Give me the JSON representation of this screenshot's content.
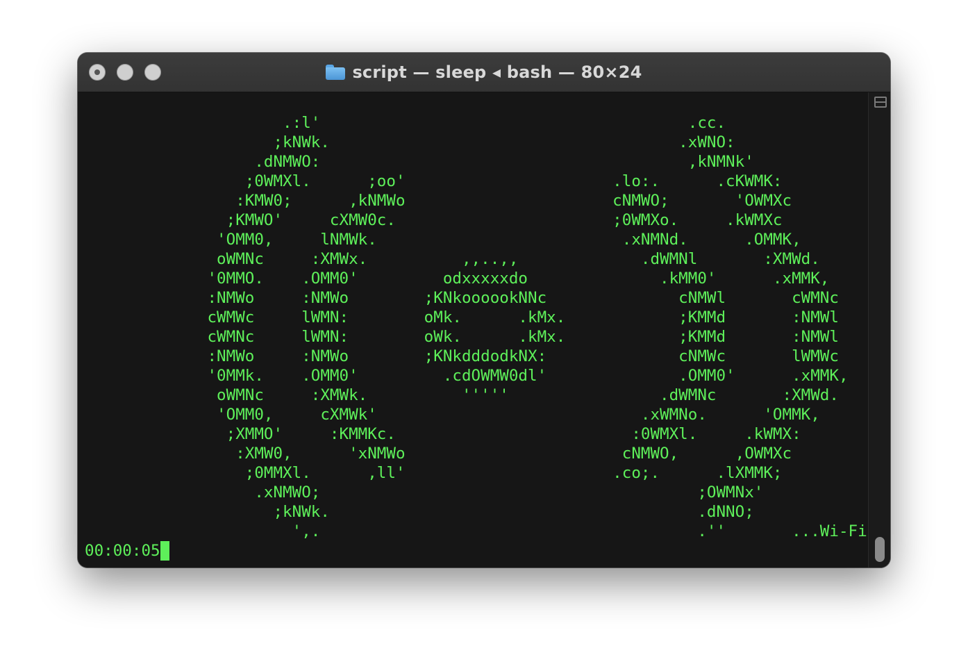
{
  "window": {
    "title": "script — sleep ◂ bash — 80×24",
    "folder_icon": "folder-icon"
  },
  "terminal": {
    "lines": [
      "                     .:l'                                       .cc.",
      "                    ;kNWk.                                     .xWNO:",
      "                  .dNMWO:                                       ,kNMNk'",
      "                 ;0WMXl.      ;oo'                      .lo:.      .cKWMK:",
      "                :KMW0;      ,kNMWo                      cNMWO;       'OWMXc",
      "               ;KMWO'     cXMW0c.                       ;0WMXo.     .kWMXc",
      "              'OMM0,     lNMWk.                          .xNMNd.      .OMMK,",
      "              oWMNc     :XMWx.          ,,..,,             .dWMNl       :XMWd.",
      "             '0MMO.    .OMM0'         odxxxxxdo              .kMM0'      .xMMK,",
      "             :NMWo     :NMWo        ;KNkoooookNNc              cNMWl       cWMNc",
      "             cWMWc     lWMN:        oMk.      .kMx.            ;KMMd       :NMWl",
      "             cWMNc     lWMN:        oWk.      .kMx.            ;KMMd       :NMWl",
      "             :NMWo     :NMWo        ;KNkdddodkNX:              cNMWc       lWMWc",
      "             '0MMk.    .OMM0'         .cdOWMW0dl'              .OMM0'      .xMMK,",
      "              oWMNc     :XMWk.          '''''                .dWMNc       :XMWd.",
      "              'OMM0,     cXMWk'                            .xWMNo.      'OMMK,",
      "               ;XMMO'     :KMMKc.                         :0WMXl.     .kWMX:",
      "                :XMW0,      'xNMWo                       cNMWO,      ,OWMXc",
      "                 ;0MMXl.      ,ll'                      .co;.      .lXMMK;",
      "                  .xNMWO;                                        ;OWMNx'",
      "                    ;kNWk.                                       .dNNO;",
      "                      ',.                                        .''       ...Wi-Fi = ON"
    ],
    "prompt_line": "00:00:05"
  },
  "colors": {
    "foreground": "#5ef05a",
    "background": "#161616",
    "titlebar": "#383838"
  }
}
